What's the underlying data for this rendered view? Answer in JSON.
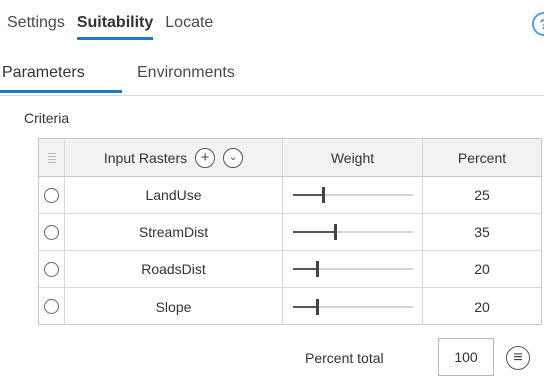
{
  "top_tabs": [
    {
      "label": "Settings",
      "active": false
    },
    {
      "label": "Suitability",
      "active": true
    },
    {
      "label": "Locate",
      "active": false
    }
  ],
  "help_icon": "?",
  "sub_tabs": [
    {
      "label": "Parameters",
      "active": true
    },
    {
      "label": "Environments",
      "active": false
    }
  ],
  "criteria": {
    "label": "Criteria",
    "headers": {
      "input_rasters": "Input Rasters",
      "weight": "Weight",
      "percent": "Percent",
      "add_icon": "+",
      "menu_icon": "⌄"
    },
    "rows": [
      {
        "name": "LandUse",
        "percent": "25",
        "weight_level": 0.25
      },
      {
        "name": "StreamDist",
        "percent": "35",
        "weight_level": 0.35
      },
      {
        "name": "RoadsDist",
        "percent": "20",
        "weight_level": 0.2
      },
      {
        "name": "Slope",
        "percent": "20",
        "weight_level": 0.2
      }
    ]
  },
  "footer": {
    "percent_total_label": "Percent total",
    "percent_total_value": "100",
    "balance_icon": "≡"
  }
}
